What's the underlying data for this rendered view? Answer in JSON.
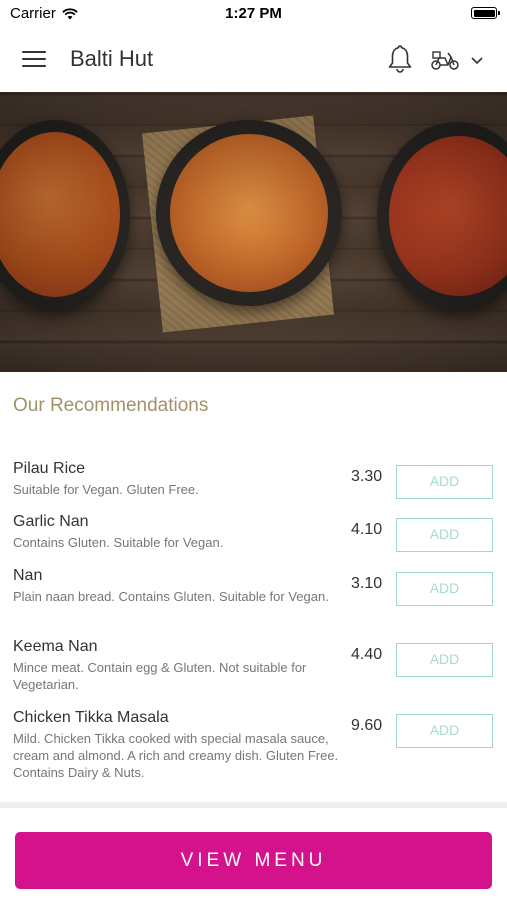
{
  "status_bar": {
    "carrier": "Carrier",
    "time": "1:27 PM"
  },
  "header": {
    "title": "Balti Hut"
  },
  "section_title": "Our Recommendations",
  "add_label": "ADD",
  "items": [
    {
      "name": "Pilau Rice",
      "desc": "Suitable for Vegan.  Gluten Free.",
      "price": "3.30"
    },
    {
      "name": "Garlic Nan",
      "desc": "Contains Gluten.  Suitable for Vegan.",
      "price": "4.10"
    },
    {
      "name": "Nan",
      "desc": "Plain naan bread. Contains Gluten. Suitable for Vegan.",
      "price": "3.10"
    },
    {
      "name": "Keema Nan",
      "desc": "Mince meat. Contain egg & Gluten. Not suitable for Vegetarian.",
      "price": "4.40"
    },
    {
      "name": "Chicken Tikka Masala",
      "desc": "Mild. Chicken  Tikka cooked with special masala sauce, cream and almond. A rich and creamy dish. Gluten Free. Contains Dairy & Nuts.",
      "price": "9.60"
    }
  ],
  "view_menu_label": "VIEW MENU",
  "colors": {
    "accent": "#d3128c",
    "section_title": "#a3916a",
    "add_border": "#9fd8c6"
  }
}
